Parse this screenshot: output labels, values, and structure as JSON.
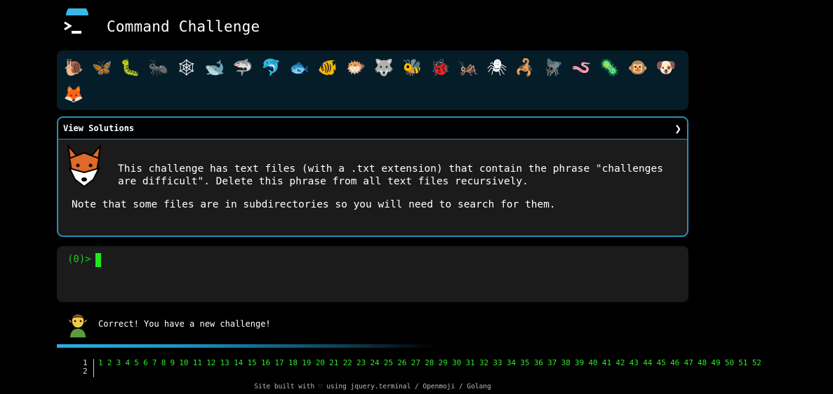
{
  "header": {
    "title": "Command Challenge"
  },
  "animals": [
    {
      "name": "snail-icon",
      "glyph": "🐌"
    },
    {
      "name": "butterfly-icon",
      "glyph": "🦋"
    },
    {
      "name": "caterpillar-icon",
      "glyph": "🐛"
    },
    {
      "name": "ant-icon",
      "glyph": "🐜"
    },
    {
      "name": "spider-web-icon",
      "glyph": "🕸"
    },
    {
      "name": "whale-icon",
      "glyph": "🐋"
    },
    {
      "name": "shark-icon",
      "glyph": "🦈"
    },
    {
      "name": "dolphin-icon",
      "glyph": "🐬"
    },
    {
      "name": "fish-icon",
      "glyph": "🐟"
    },
    {
      "name": "tropical-fish-icon",
      "glyph": "🐠"
    },
    {
      "name": "blowfish-icon",
      "glyph": "🐡"
    },
    {
      "name": "wolf-icon",
      "glyph": "🐺"
    },
    {
      "name": "honeybee-icon",
      "glyph": "🐝"
    },
    {
      "name": "lady-beetle-icon",
      "glyph": "🐞"
    },
    {
      "name": "cricket-icon",
      "glyph": "🦗"
    },
    {
      "name": "spider-icon",
      "glyph": "🕷"
    },
    {
      "name": "scorpion-icon",
      "glyph": "🦂"
    },
    {
      "name": "fly-icon",
      "glyph": "🪰"
    },
    {
      "name": "worm-icon",
      "glyph": "🪱"
    },
    {
      "name": "microbe-icon",
      "glyph": "🦠"
    },
    {
      "name": "monkey-icon",
      "glyph": "🐵"
    },
    {
      "name": "dog-icon",
      "glyph": "🐶"
    },
    {
      "name": "fox-icon",
      "glyph": "🦊"
    }
  ],
  "solutions": {
    "label": "View Solutions",
    "description": "This challenge has text files (with a .txt extension) that contain the phrase \"challenges are difficult\". Delete this phrase from all text files recursively.",
    "note": "Note that some files are in subdirectories so you will need to search for them."
  },
  "terminal": {
    "prompt": "(0)>"
  },
  "status": {
    "message": "Correct! You have a new challenge!"
  },
  "levels": {
    "gutter": [
      "1",
      "2"
    ],
    "numbers": [
      "1",
      "2",
      "3",
      "4",
      "5",
      "6",
      "7",
      "8",
      "9",
      "10",
      "11",
      "12",
      "13",
      "14",
      "15",
      "16",
      "17",
      "18",
      "19",
      "20",
      "21",
      "22",
      "23",
      "24",
      "25",
      "26",
      "27",
      "28",
      "29",
      "30",
      "31",
      "32",
      "33",
      "34",
      "35",
      "36",
      "37",
      "38",
      "39",
      "40",
      "41",
      "42",
      "43",
      "44",
      "45",
      "46",
      "47",
      "48",
      "49",
      "50",
      "51",
      "52"
    ]
  },
  "footer": "Site built with ♡ using jquery.terminal / Openmoji / Golang",
  "colors": {
    "accent": "#2a8fb8",
    "prompt": "#1fc820",
    "levels": "#2de82a",
    "panel": "#1b1b1b",
    "animal_bar": "#051d29"
  }
}
